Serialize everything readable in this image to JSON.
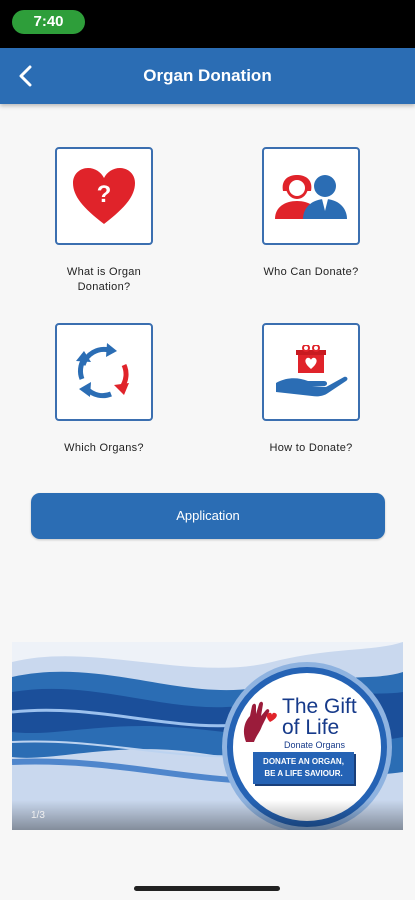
{
  "status_bar": {
    "time": "7:40"
  },
  "app_bar": {
    "title": "Organ Donation",
    "back_icon": "chevron-left-icon"
  },
  "tiles": [
    {
      "label": "What is Organ Donation?",
      "icon": "heart-question-icon"
    },
    {
      "label": "Who Can Donate?",
      "icon": "people-icon"
    },
    {
      "label": "Which Organs?",
      "icon": "refresh-cycle-icon"
    },
    {
      "label": "How to Donate?",
      "icon": "hand-gift-icon"
    }
  ],
  "application_button": {
    "label": "Application"
  },
  "banner": {
    "title_line1": "The Gift",
    "title_line2": "of Life",
    "subtitle": "Donate Organs",
    "tag_line1": "DONATE AN ORGAN,",
    "tag_line2": "BE A LIFE SAVIOUR.",
    "page_indicator": "1/3"
  },
  "colors": {
    "primary": "#2b6db4",
    "heart_red": "#e0232a",
    "status_green": "#2e9e3a"
  }
}
